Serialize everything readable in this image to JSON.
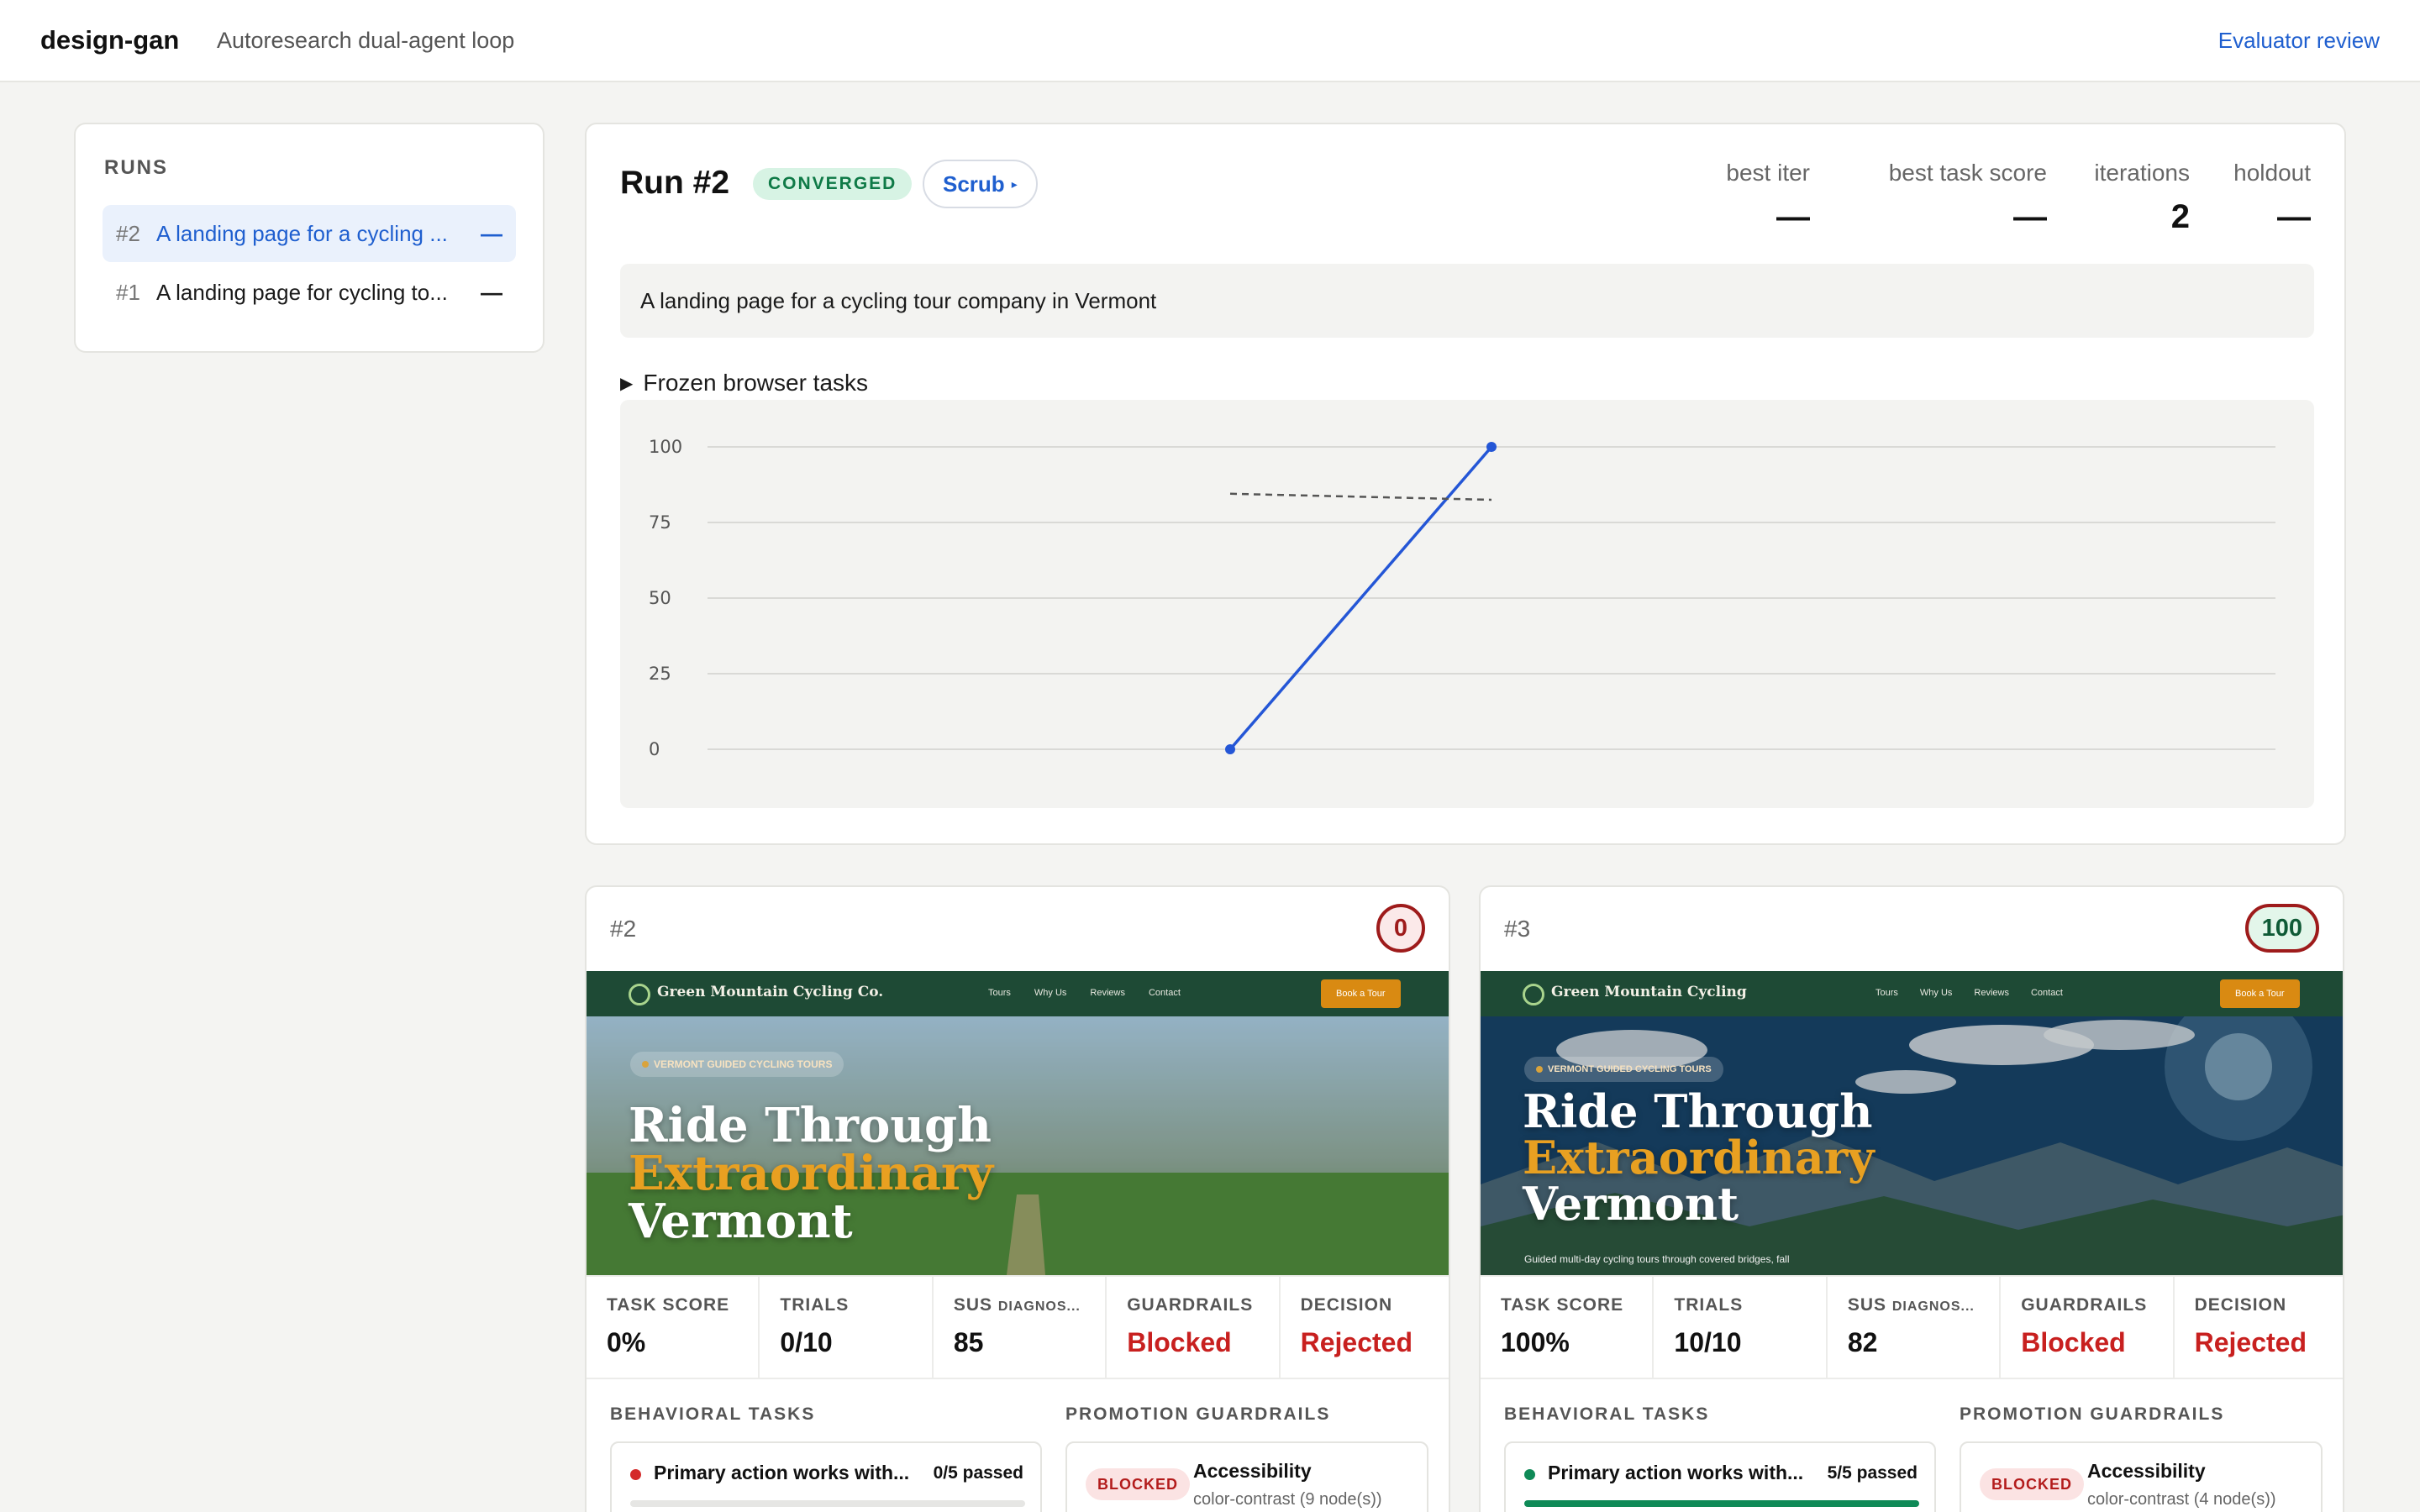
{
  "header": {
    "brand": "design-gan",
    "tagline": "Autoresearch dual-agent loop",
    "evaluator_link": "Evaluator review"
  },
  "sidebar": {
    "title": "RUNS",
    "items": [
      {
        "num": "#2",
        "label": "A landing page for a cycling ...",
        "status": "—",
        "active": true
      },
      {
        "num": "#1",
        "label": "A landing page for cycling to...",
        "status": "—",
        "active": false
      }
    ]
  },
  "run": {
    "title": "Run #2",
    "badge": "CONVERGED",
    "scrub_label": "Scrub",
    "scrub_caret": "▸",
    "stats": [
      {
        "key": "best iter",
        "value": "—"
      },
      {
        "key": "best task score",
        "value": "—"
      },
      {
        "key": "iterations",
        "value": "2"
      },
      {
        "key": "holdout",
        "value": "—"
      }
    ],
    "prompt": "A landing page for a cycling tour company in Vermont",
    "frozen_label": "Frozen browser tasks",
    "frozen_triangle": "▶"
  },
  "chart_data": {
    "type": "line",
    "title": "",
    "xlabel": "",
    "ylabel": "",
    "ylim": [
      0,
      100
    ],
    "yticks": [
      "100",
      "75",
      "50",
      "25",
      "0"
    ],
    "x": [
      2,
      3
    ],
    "series": [
      {
        "values": [
          0,
          100
        ],
        "color": "#2456d6",
        "style": "solid",
        "markers": true
      },
      {
        "values": [
          84.5,
          82.5
        ],
        "color": "#555555",
        "style": "dashed",
        "markers": false
      }
    ],
    "xlim": [
      0,
      6
    ],
    "grid": true
  },
  "iterations": [
    {
      "id": "#2",
      "score": "0",
      "score_state": "bad",
      "preview": {
        "brand": "Green Mountain Cycling Co.",
        "links": [
          "Tours",
          "Why Us",
          "Reviews",
          "Contact"
        ],
        "cta": "Book a Tour",
        "kicker": "VERMONT GUIDED CYCLING TOURS",
        "headline_1": "Ride Through",
        "headline_2": "Extraordinary",
        "headline_3": "Vermont",
        "sub": ""
      },
      "metrics": [
        {
          "key": "TASK SCORE",
          "value": "0%",
          "red": false
        },
        {
          "key": "TRIALS",
          "value": "0/10",
          "red": false
        },
        {
          "key": "SUS",
          "key_small": "DIAGNOS...",
          "value": "85",
          "red": false
        },
        {
          "key": "GUARDRAILS",
          "value": "Blocked",
          "red": true
        },
        {
          "key": "DECISION",
          "value": "Rejected",
          "red": true
        }
      ],
      "behavioral_title": "BEHAVIORAL TASKS",
      "guardrails_title": "PROMOTION GUARDRAILS",
      "task": {
        "name": "Primary action works with...",
        "passed": "0/5 passed",
        "pass_fraction": 0,
        "dot": "#d42a2a"
      },
      "guard": {
        "badge": "BLOCKED",
        "name": "Accessibility",
        "detail": "color-contrast (9 node(s))"
      }
    },
    {
      "id": "#3",
      "score": "100",
      "score_state": "good",
      "preview": {
        "brand": "Green Mountain Cycling",
        "links": [
          "Tours",
          "Why Us",
          "Reviews",
          "Contact"
        ],
        "cta": "Book a Tour",
        "kicker": "VERMONT GUIDED CYCLING TOURS",
        "headline_1": "Ride Through",
        "headline_2": "Extraordinary",
        "headline_3": "Vermont",
        "sub": "Guided multi-day cycling tours through covered bridges, fall"
      },
      "metrics": [
        {
          "key": "TASK SCORE",
          "value": "100%",
          "red": false
        },
        {
          "key": "TRIALS",
          "value": "10/10",
          "red": false
        },
        {
          "key": "SUS",
          "key_small": "DIAGNOS...",
          "value": "82",
          "red": false
        },
        {
          "key": "GUARDRAILS",
          "value": "Blocked",
          "red": true
        },
        {
          "key": "DECISION",
          "value": "Rejected",
          "red": true
        }
      ],
      "behavioral_title": "BEHAVIORAL TASKS",
      "guardrails_title": "PROMOTION GUARDRAILS",
      "task": {
        "name": "Primary action works with...",
        "passed": "5/5 passed",
        "pass_fraction": 1,
        "dot": "#0f8a57"
      },
      "guard": {
        "badge": "BLOCKED",
        "name": "Accessibility",
        "detail": "color-contrast (4 node(s))"
      }
    }
  ]
}
